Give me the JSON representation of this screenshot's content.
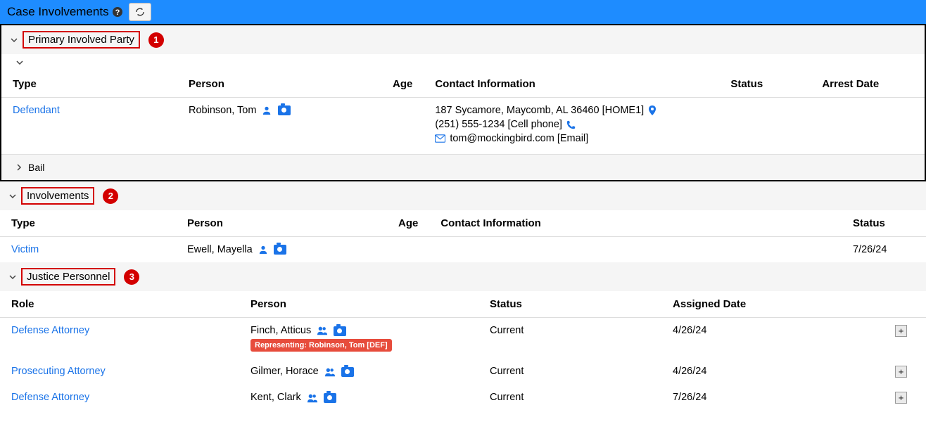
{
  "colors": {
    "accent": "#1e8cff",
    "link": "#1a73e8",
    "danger": "#e74c3c",
    "marker": "#d30000"
  },
  "header": {
    "title": "Case Involvements"
  },
  "sections": {
    "primary": {
      "title": "Primary Involved Party",
      "marker": "1",
      "bail_label": "Bail",
      "columns": {
        "type": "Type",
        "person": "Person",
        "age": "Age",
        "contact": "Contact Information",
        "status": "Status",
        "arrest": "Arrest Date"
      },
      "row": {
        "type": "Defendant",
        "person": "Robinson, Tom",
        "age": "",
        "address": "187 Sycamore, Maycomb, AL 36460 [HOME1]",
        "phone": "(251) 555-1234 [Cell phone]",
        "email": "tom@mockingbird.com [Email]",
        "status": "",
        "arrest": ""
      }
    },
    "involvements": {
      "title": "Involvements",
      "marker": "2",
      "columns": {
        "type": "Type",
        "person": "Person",
        "age": "Age",
        "contact": "Contact Information",
        "status": "Status"
      },
      "row": {
        "type": "Victim",
        "person": "Ewell, Mayella",
        "age": "",
        "contact": "",
        "status": "7/26/24"
      }
    },
    "justice": {
      "title": "Justice Personnel",
      "marker": "3",
      "columns": {
        "role": "Role",
        "person": "Person",
        "status": "Status",
        "assigned": "Assigned Date"
      },
      "rows": [
        {
          "role": "Defense Attorney",
          "person": "Finch, Atticus",
          "rep": "Representing: Robinson, Tom [DEF]",
          "status": "Current",
          "assigned": "4/26/24"
        },
        {
          "role": "Prosecuting Attorney",
          "person": "Gilmer, Horace",
          "rep": "",
          "status": "Current",
          "assigned": "4/26/24"
        },
        {
          "role": "Defense Attorney",
          "person": "Kent, Clark",
          "rep": "",
          "status": "Current",
          "assigned": "7/26/24"
        }
      ]
    }
  }
}
